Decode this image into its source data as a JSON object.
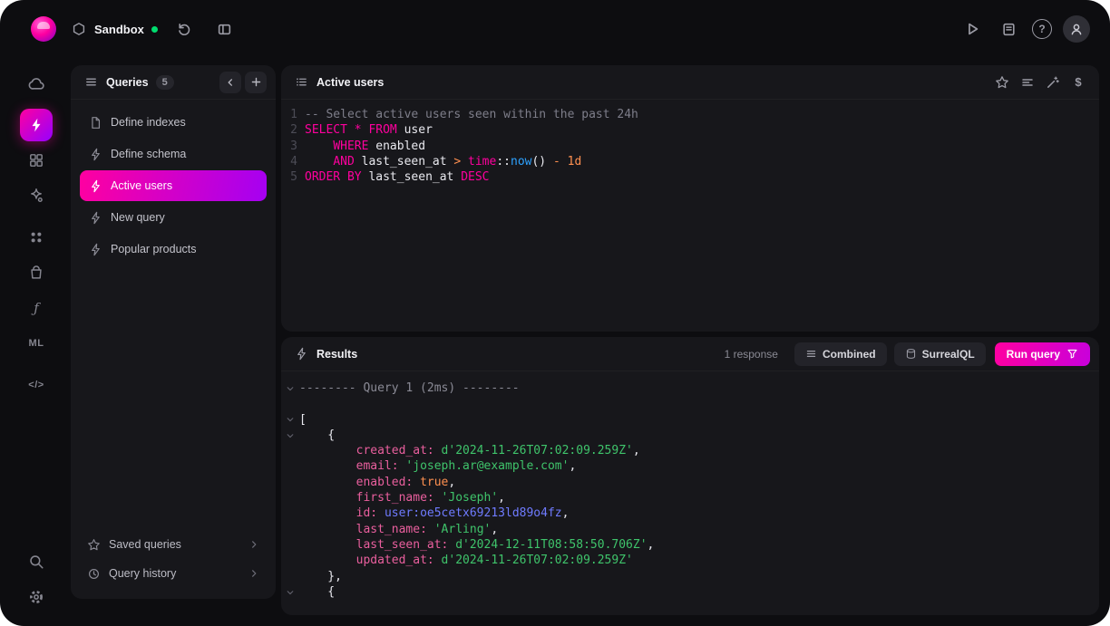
{
  "topbar": {
    "instance_label": "Sandbox",
    "help_glyph": "?"
  },
  "rail": {
    "functions_glyph": "ƒ",
    "ml_label": "ML",
    "docs_glyph": "</>"
  },
  "queries_panel": {
    "title": "Queries",
    "count": "5",
    "items": [
      {
        "label": "Define indexes"
      },
      {
        "label": "Define schema"
      },
      {
        "label": "Active users"
      },
      {
        "label": "New query"
      },
      {
        "label": "Popular products"
      }
    ],
    "saved_queries_label": "Saved queries",
    "query_history_label": "Query history"
  },
  "editor": {
    "title": "Active users",
    "variables_glyph": "$",
    "lines": [
      {
        "n": "1",
        "seg": [
          [
            "-- Select active users seen within the past 24h",
            "com"
          ]
        ]
      },
      {
        "n": "2",
        "seg": [
          [
            "SELECT",
            "kw"
          ],
          [
            " ",
            "pl"
          ],
          [
            "*",
            "kw"
          ],
          [
            " ",
            "pl"
          ],
          [
            "FROM",
            "kw"
          ],
          [
            " user",
            "pl"
          ]
        ]
      },
      {
        "n": "3",
        "seg": [
          [
            "    ",
            "pl"
          ],
          [
            "WHERE",
            "kw"
          ],
          [
            " enabled",
            "pl"
          ]
        ]
      },
      {
        "n": "4",
        "seg": [
          [
            "    ",
            "pl"
          ],
          [
            "AND",
            "kw"
          ],
          [
            " last_seen_at ",
            "pl"
          ],
          [
            ">",
            "op"
          ],
          [
            " ",
            "pl"
          ],
          [
            "time",
            "kw"
          ],
          [
            "::",
            "pl"
          ],
          [
            "now",
            "fn"
          ],
          [
            "()",
            "pl"
          ],
          [
            " ",
            "pl"
          ],
          [
            "-",
            "op"
          ],
          [
            " ",
            "pl"
          ],
          [
            "1d",
            "num"
          ]
        ]
      },
      {
        "n": "5",
        "seg": [
          [
            "ORDER BY",
            "kw"
          ],
          [
            " last_seen_at ",
            "pl"
          ],
          [
            "DESC",
            "kw"
          ]
        ]
      }
    ]
  },
  "results": {
    "title": "Results",
    "response_count": "1 response",
    "combined_label": "Combined",
    "surrealql_label": "SurrealQL",
    "run_query_label": "Run query",
    "lines": [
      {
        "chev": true,
        "seg": [
          [
            "-------- Query 1 (2ms) --------",
            "sep"
          ]
        ]
      },
      {
        "seg": [
          [
            " ",
            "pl"
          ]
        ]
      },
      {
        "chev": true,
        "seg": [
          [
            "[",
            "pl"
          ]
        ]
      },
      {
        "chev": true,
        "seg": [
          [
            "    {",
            "pl"
          ]
        ]
      },
      {
        "seg": [
          [
            "        ",
            "pl"
          ],
          [
            "created_at:",
            "key"
          ],
          [
            " ",
            "pl"
          ],
          [
            "d'2024-11-26T07:02:09.259Z'",
            "str"
          ],
          [
            ",",
            "pl"
          ]
        ]
      },
      {
        "seg": [
          [
            "        ",
            "pl"
          ],
          [
            "email:",
            "key"
          ],
          [
            " ",
            "pl"
          ],
          [
            "'joseph.ar@example.com'",
            "str"
          ],
          [
            ",",
            "pl"
          ]
        ]
      },
      {
        "seg": [
          [
            "        ",
            "pl"
          ],
          [
            "enabled:",
            "key"
          ],
          [
            " ",
            "pl"
          ],
          [
            "true",
            "bool"
          ],
          [
            ",",
            "pl"
          ]
        ]
      },
      {
        "seg": [
          [
            "        ",
            "pl"
          ],
          [
            "first_name:",
            "key"
          ],
          [
            " ",
            "pl"
          ],
          [
            "'Joseph'",
            "str"
          ],
          [
            ",",
            "pl"
          ]
        ]
      },
      {
        "seg": [
          [
            "        ",
            "pl"
          ],
          [
            "id:",
            "key"
          ],
          [
            " ",
            "pl"
          ],
          [
            "user:oe5cetx69213ld89o4fz",
            "rec"
          ],
          [
            ",",
            "pl"
          ]
        ]
      },
      {
        "seg": [
          [
            "        ",
            "pl"
          ],
          [
            "last_name:",
            "key"
          ],
          [
            " ",
            "pl"
          ],
          [
            "'Arling'",
            "str"
          ],
          [
            ",",
            "pl"
          ]
        ]
      },
      {
        "seg": [
          [
            "        ",
            "pl"
          ],
          [
            "last_seen_at:",
            "key"
          ],
          [
            " ",
            "pl"
          ],
          [
            "d'2024-12-11T08:58:50.706Z'",
            "str"
          ],
          [
            ",",
            "pl"
          ]
        ]
      },
      {
        "seg": [
          [
            "        ",
            "pl"
          ],
          [
            "updated_at:",
            "key"
          ],
          [
            " ",
            "pl"
          ],
          [
            "d'2024-11-26T07:02:09.259Z'",
            "str"
          ]
        ]
      },
      {
        "seg": [
          [
            "    },",
            "pl"
          ]
        ]
      },
      {
        "chev": true,
        "seg": [
          [
            "    {",
            "pl"
          ]
        ]
      }
    ]
  },
  "colors": {
    "accent": "#ff009e",
    "gradient_from": "#ff00a0",
    "gradient_to": "#9600ff",
    "status_green": "#00dc6f"
  }
}
